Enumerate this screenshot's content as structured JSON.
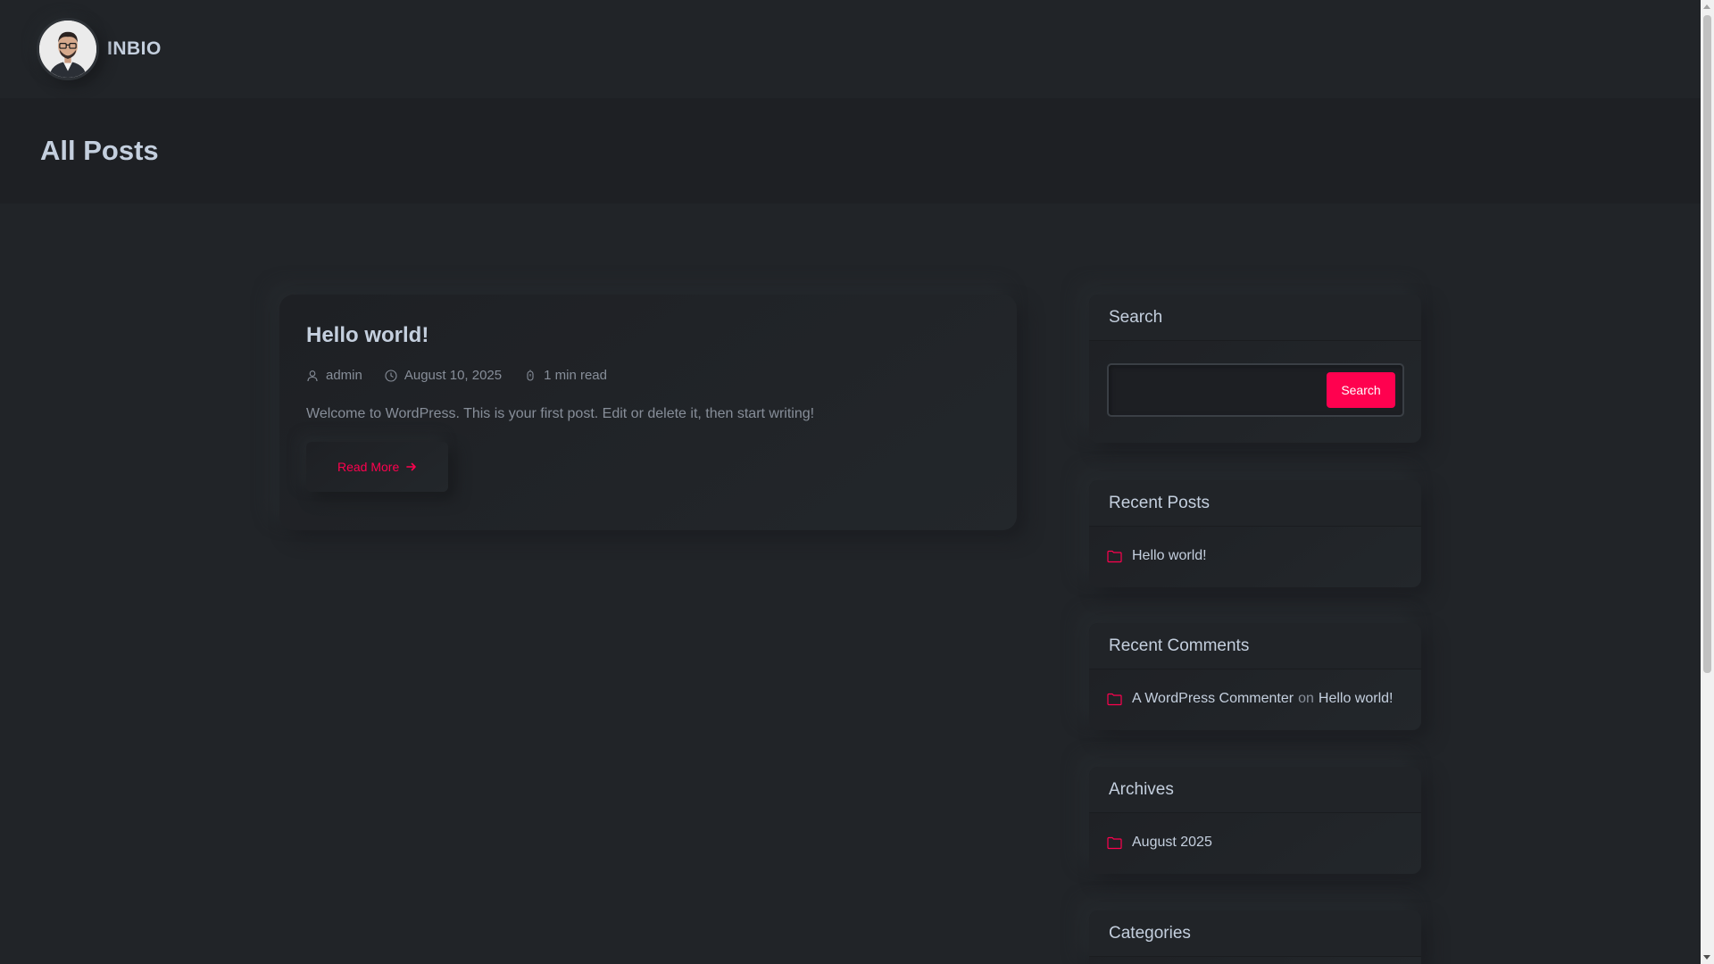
{
  "header": {
    "logo_text": "INBIO"
  },
  "page": {
    "title": "All Posts"
  },
  "post": {
    "title": "Hello world!",
    "author": "admin",
    "date": "August 10, 2025",
    "read_time": "1 min read",
    "excerpt": "Welcome to WordPress. This is your first post. Edit or delete it, then start writing!",
    "read_more_label": "Read More"
  },
  "sidebar": {
    "search": {
      "title": "Search",
      "input_value": "",
      "button_label": "Search"
    },
    "recent_posts": {
      "title": "Recent Posts",
      "items": [
        "Hello world!"
      ]
    },
    "recent_comments": {
      "title": "Recent Comments",
      "author": "A WordPress Commenter",
      "on": "on",
      "post": "Hello world!"
    },
    "archives": {
      "title": "Archives",
      "items": [
        "August 2025"
      ]
    },
    "categories": {
      "title": "Categories"
    }
  },
  "colors": {
    "background": "#212428",
    "accent": "#ff014f",
    "text": "#c4cfde",
    "muted": "#878e99"
  },
  "icons": {
    "author": "user-icon",
    "date": "clock-icon",
    "read_time": "stopwatch-icon",
    "read_more": "arrow-right-icon",
    "widget_item": "folder-icon"
  }
}
